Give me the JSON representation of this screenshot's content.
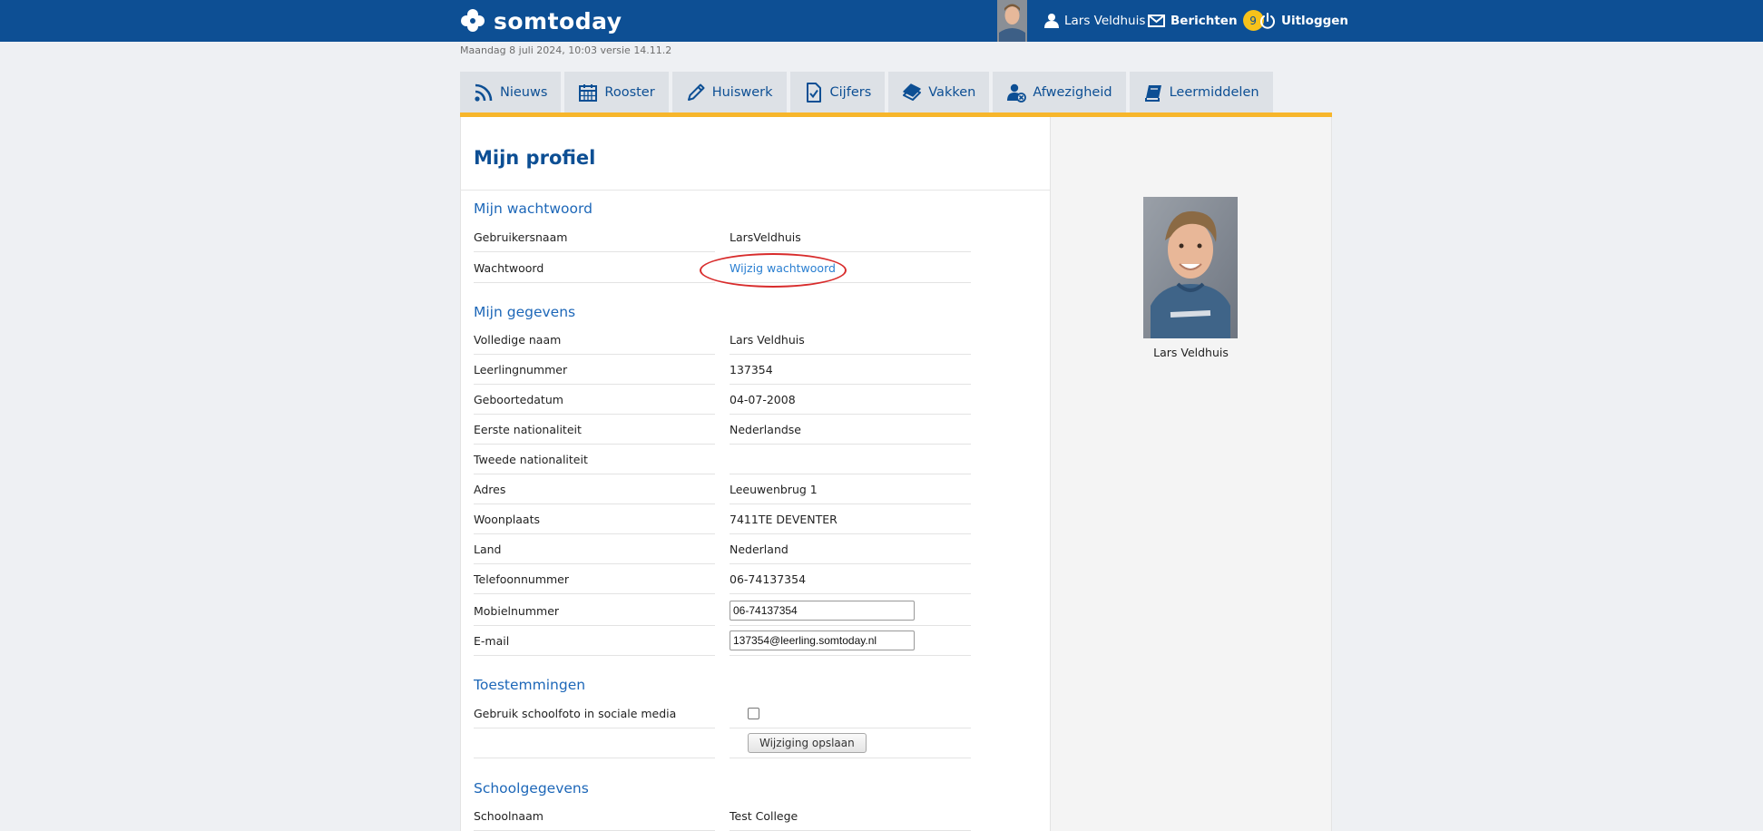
{
  "header": {
    "brand": "somtoday",
    "user_name": "Lars Veldhuis",
    "messages_label": "Berichten",
    "messages_count": "9",
    "logout_label": "Uitloggen"
  },
  "datebar": {
    "text": "Maandag 8 juli 2024, 10:03 versie 14.11.2"
  },
  "tabs": [
    {
      "label": "Nieuws",
      "icon": "rss-icon"
    },
    {
      "label": "Rooster",
      "icon": "calendar-icon"
    },
    {
      "label": "Huiswerk",
      "icon": "pencil-icon"
    },
    {
      "label": "Cijfers",
      "icon": "checked-document-icon"
    },
    {
      "label": "Vakken",
      "icon": "books-icon"
    },
    {
      "label": "Afwezigheid",
      "icon": "user-absence-icon"
    },
    {
      "label": "Leermiddelen",
      "icon": "book-icon"
    }
  ],
  "colors": {
    "brand": "#0d4f94",
    "accent": "#f7b62b",
    "link": "#2a7fd1",
    "highlight": "#d82c2c"
  },
  "page": {
    "title": "Mijn profiel"
  },
  "password_section": {
    "title": "Mijn wachtwoord",
    "username_label": "Gebruikersnaam",
    "username_value": "LarsVeldhuis",
    "password_label": "Wachtwoord",
    "change_password_link": "Wijzig wachtwoord"
  },
  "details_section": {
    "title": "Mijn gegevens",
    "rows": [
      {
        "label": "Volledige naam",
        "value": "Lars Veldhuis"
      },
      {
        "label": "Leerlingnummer",
        "value": "137354"
      },
      {
        "label": "Geboortedatum",
        "value": "04-07-2008"
      },
      {
        "label": "Eerste nationaliteit",
        "value": "Nederlandse"
      },
      {
        "label": "Tweede nationaliteit",
        "value": ""
      },
      {
        "label": "Adres",
        "value": "Leeuwenbrug 1"
      },
      {
        "label": "Woonplaats",
        "value": "7411TE DEVENTER"
      },
      {
        "label": "Land",
        "value": "Nederland"
      },
      {
        "label": "Telefoonnummer",
        "value": "06-74137354"
      }
    ],
    "mobile_label": "Mobielnummer",
    "mobile_value": "06-74137354",
    "email_label": "E-mail",
    "email_value": "137354@leerling.somtoday.nl"
  },
  "permissions_section": {
    "title": "Toestemmingen",
    "photo_social_label": "Gebruik schoolfoto in sociale media",
    "photo_social_checked": false,
    "save_button": "Wijziging opslaan"
  },
  "school_section": {
    "title": "Schoolgegevens",
    "school_name_label": "Schoolnaam",
    "school_name_value": "Test College"
  },
  "profile_card": {
    "name": "Lars Veldhuis"
  }
}
